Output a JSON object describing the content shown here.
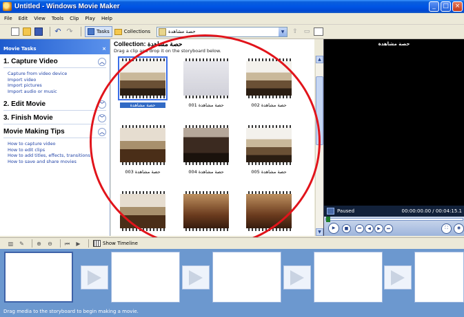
{
  "window": {
    "title": "Untitled - Windows Movie Maker"
  },
  "menu": [
    "File",
    "Edit",
    "View",
    "Tools",
    "Clip",
    "Play",
    "Help"
  ],
  "toolbar": {
    "tasks_label": "Tasks",
    "collections_label": "Collections",
    "collection_value": "حصة مشاهدة"
  },
  "tasks_pane": {
    "header": "Movie Tasks",
    "close": "×",
    "sections": [
      {
        "title": "1. Capture Video",
        "state": "expanded",
        "links": [
          "Capture from video device",
          "Import video",
          "Import pictures",
          "Import audio or music"
        ]
      },
      {
        "title": "2. Edit Movie",
        "state": "collapsed",
        "links": []
      },
      {
        "title": "3. Finish Movie",
        "state": "collapsed",
        "links": []
      },
      {
        "title": "Movie Making Tips",
        "state": "expanded",
        "links": [
          "How to capture video",
          "How to edit clips",
          "How to add titles, effects, transitions",
          "How to save and share movies"
        ]
      }
    ]
  },
  "collection": {
    "title": "Collection: حصة مشاهدة",
    "subtitle": "Drag a clip and drop it on the storyboard below.",
    "clips": [
      {
        "label": "حصة مشاهدة",
        "selected": true,
        "scene": "room"
      },
      {
        "label": "حصة مشاهدة 001",
        "selected": false,
        "scene": "board"
      },
      {
        "label": "حصة مشاهدة 002",
        "selected": false,
        "scene": "room"
      },
      {
        "label": "حصة مشاهدة 003",
        "selected": false,
        "scene": "desk"
      },
      {
        "label": "حصة مشاهدة 004",
        "selected": false,
        "scene": "dark"
      },
      {
        "label": "حصة مشاهدة 005",
        "selected": false,
        "scene": "room"
      },
      {
        "label": "",
        "selected": false,
        "scene": "desk"
      },
      {
        "label": "",
        "selected": false,
        "scene": "warm"
      },
      {
        "label": "",
        "selected": false,
        "scene": "warm"
      }
    ]
  },
  "player": {
    "title": "حصة مشاهدة",
    "status": "Paused",
    "time": "00:00:00.00 / 00:04:15.1"
  },
  "storyboard": {
    "show_timeline_label": "Show Timeline",
    "status": "Drag media to the storyboard to begin making a movie."
  },
  "colors": {
    "titlebar": "#0055e5",
    "storyboard_bg": "#6c98cf",
    "annotation_circle": "#e1141b"
  }
}
